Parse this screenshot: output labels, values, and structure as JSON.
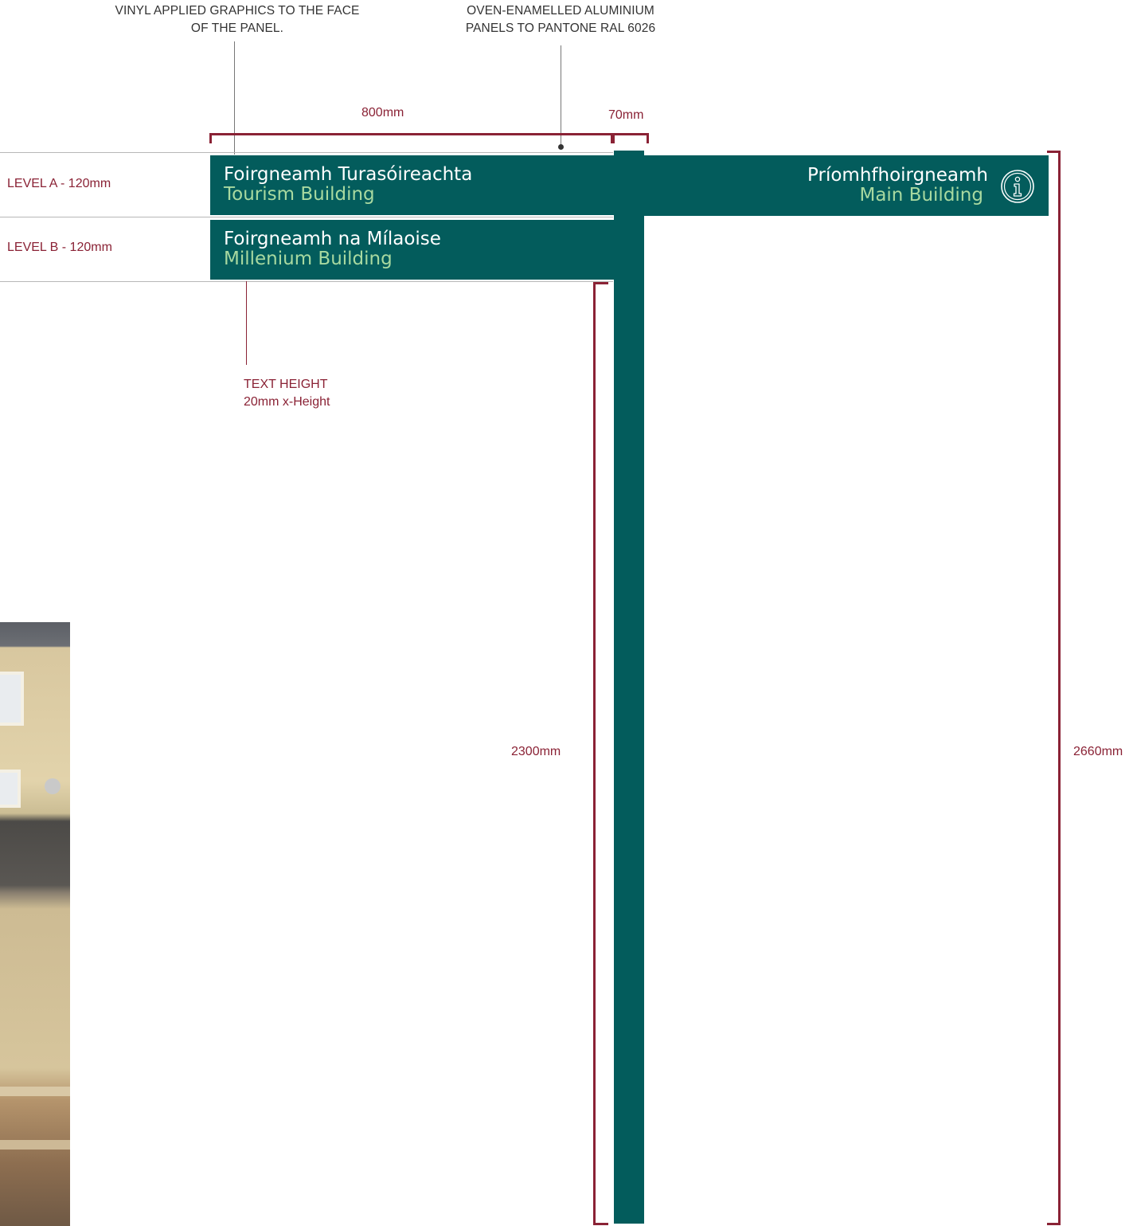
{
  "annotations": {
    "vinyl": [
      "VINYL APPLIED GRAPHICS TO THE FACE",
      "OF THE PANEL."
    ],
    "aluminium": [
      "OVEN-ENAMELLED ALUMINIUM",
      "PANELS TO PANTONE RAL 6026"
    ],
    "text_height": [
      "TEXT HEIGHT",
      "20mm x-Height"
    ]
  },
  "dimensions": {
    "panel_width": "800mm",
    "post_width": "70mm",
    "clearance_height": "2300mm",
    "total_height": "2660mm"
  },
  "levels": {
    "a": "LEVEL A - 120mm",
    "b": "LEVEL B - 120mm"
  },
  "panels": {
    "left_a": {
      "title": "Foirgneamh Turasóireachta",
      "subtitle": "Tourism Building"
    },
    "left_b": {
      "title": "Foirgneamh na Mílaoise",
      "subtitle": "Millenium Building"
    },
    "right_a": {
      "title": "Príomhfhoirgneamh",
      "subtitle": "Main Building"
    }
  },
  "colors": {
    "panel": "#035c5c",
    "accent_text": "#a8d9a0",
    "dimension": "#8a2235"
  },
  "icons": {
    "info": "info-icon"
  }
}
